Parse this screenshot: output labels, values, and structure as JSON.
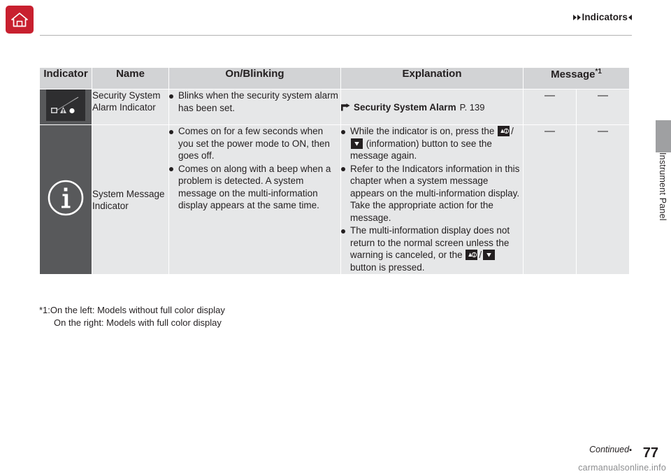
{
  "header": {
    "home_icon": "home-icon",
    "breadcrumb": "Indicators"
  },
  "side_tab": {
    "label": "Instrument Panel"
  },
  "table": {
    "columns": [
      "Indicator",
      "Name",
      "On/Blinking",
      "Explanation",
      "Message*1",
      ""
    ],
    "rows": [
      {
        "icon": "security-system-alarm-icon",
        "name": "Security System Alarm Indicator",
        "on_blinking": [
          "Blinks when the security system alarm has been set."
        ],
        "explanation_ref": {
          "arrow": "2",
          "bold": "Security System Alarm",
          "page": "P. 139"
        },
        "message_left": "—",
        "message_right": "—"
      },
      {
        "icon": "system-message-indicator-icon",
        "name": "System Message Indicator",
        "on_blinking": [
          "Comes on for a few seconds when you set the power mode to ON, then goes off.",
          "Comes on along with a beep when a problem is detected. A system message on the multi-information display appears at the same time."
        ],
        "explanation": [
          "While the indicator is on, press the  /  (information) button to see the message again.",
          "Refer to the Indicators information in this chapter when a system message appears on the multi-information display. Take the appropriate action for the message.",
          "The multi-information display does not return to the normal screen unless the warning is canceled, or the  /  button is pressed."
        ],
        "message_left": "—",
        "message_right": "—"
      }
    ]
  },
  "footnote": {
    "line1": "*1:On the left: Models without full color display",
    "line2": "On the right: Models with full color display"
  },
  "footer": {
    "continued": "Continued",
    "page_number": "77",
    "watermark": "carmanualsonline.info"
  }
}
